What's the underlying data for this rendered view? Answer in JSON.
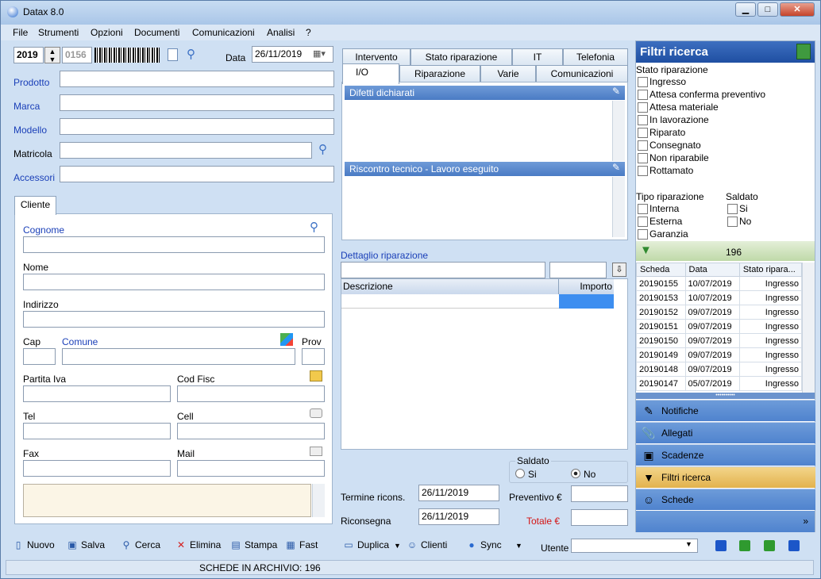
{
  "window": {
    "title": "Datax 8.0",
    "min": "▁",
    "max": "□",
    "close": "✕"
  },
  "menu": [
    "File",
    "Strumenti",
    "Opzioni",
    "Documenti",
    "Comunicazioni",
    "Analisi",
    "?"
  ],
  "top": {
    "year": "2019",
    "number": "0156",
    "data_label": "Data",
    "data_value": "26/11/2019"
  },
  "fields": {
    "prodotto": "Prodotto",
    "marca": "Marca",
    "modello": "Modello",
    "matricola": "Matricola",
    "accessori": "Accessori"
  },
  "cliente": {
    "tab": "Cliente",
    "cognome": "Cognome",
    "nome": "Nome",
    "indirizzo": "Indirizzo",
    "cap": "Cap",
    "comune": "Comune",
    "prov": "Prov",
    "piva": "Partita Iva",
    "codfisc": "Cod Fisc",
    "tel": "Tel",
    "cell": "Cell",
    "fax": "Fax",
    "mail": "Mail"
  },
  "tabs_row1": [
    "Intervento",
    "Stato riparazione",
    "IT",
    "Telefonia"
  ],
  "tabs_row2": [
    "I/O",
    "Riparazione",
    "Varie",
    "Comunicazioni"
  ],
  "io": {
    "difetti": "Difetti dichiarati",
    "riscontro": "Riscontro tecnico - Lavoro eseguito"
  },
  "dettaglio": {
    "title": "Dettaglio riparazione",
    "col_desc": "Descrizione",
    "col_importo": "Importo"
  },
  "saldato": {
    "label": "Saldato",
    "si": "Si",
    "no": "No"
  },
  "bottom": {
    "termine_label": "Termine ricons.",
    "termine_value": "26/11/2019",
    "riconsegna_label": "Riconsegna",
    "riconsegna_value": "26/11/2019",
    "preventivo": "Preventivo €",
    "totale": "Totale €"
  },
  "filtri": {
    "title": "Filtri ricerca",
    "stato_title": "Stato riparazione",
    "stati": [
      "Ingresso",
      "Attesa conferma preventivo",
      "Attesa materiale",
      "In lavorazione",
      "Riparato",
      "Consegnato",
      "Non riparabile",
      "Rottamato"
    ],
    "tipo_title": "Tipo riparazione",
    "tipi": [
      "Interna",
      "Esterna",
      "Garanzia"
    ],
    "saldato_title": "Saldato",
    "saldato_opts": [
      "Si",
      "No"
    ],
    "count": "196"
  },
  "grid": {
    "headers": [
      "Scheda",
      "Data",
      "Stato ripara..."
    ],
    "rows": [
      [
        "20190155",
        "10/07/2019",
        "Ingresso"
      ],
      [
        "20190153",
        "10/07/2019",
        "Ingresso"
      ],
      [
        "20190152",
        "09/07/2019",
        "Ingresso"
      ],
      [
        "20190151",
        "09/07/2019",
        "Ingresso"
      ],
      [
        "20190150",
        "09/07/2019",
        "Ingresso"
      ],
      [
        "20190149",
        "09/07/2019",
        "Ingresso"
      ],
      [
        "20190148",
        "09/07/2019",
        "Ingresso"
      ],
      [
        "20190147",
        "05/07/2019",
        "Ingresso"
      ]
    ]
  },
  "side": [
    "Notifiche",
    "Allegati",
    "Scadenze",
    "Filtri ricerca",
    "Schede"
  ],
  "toolbar": [
    "Nuovo",
    "Salva",
    "Cerca",
    "Elimina",
    "Stampa",
    "Fast",
    "Duplica",
    "Clienti",
    "Sync"
  ],
  "utente_label": "Utente",
  "status": "SCHEDE IN ARCHIVIO: 196"
}
